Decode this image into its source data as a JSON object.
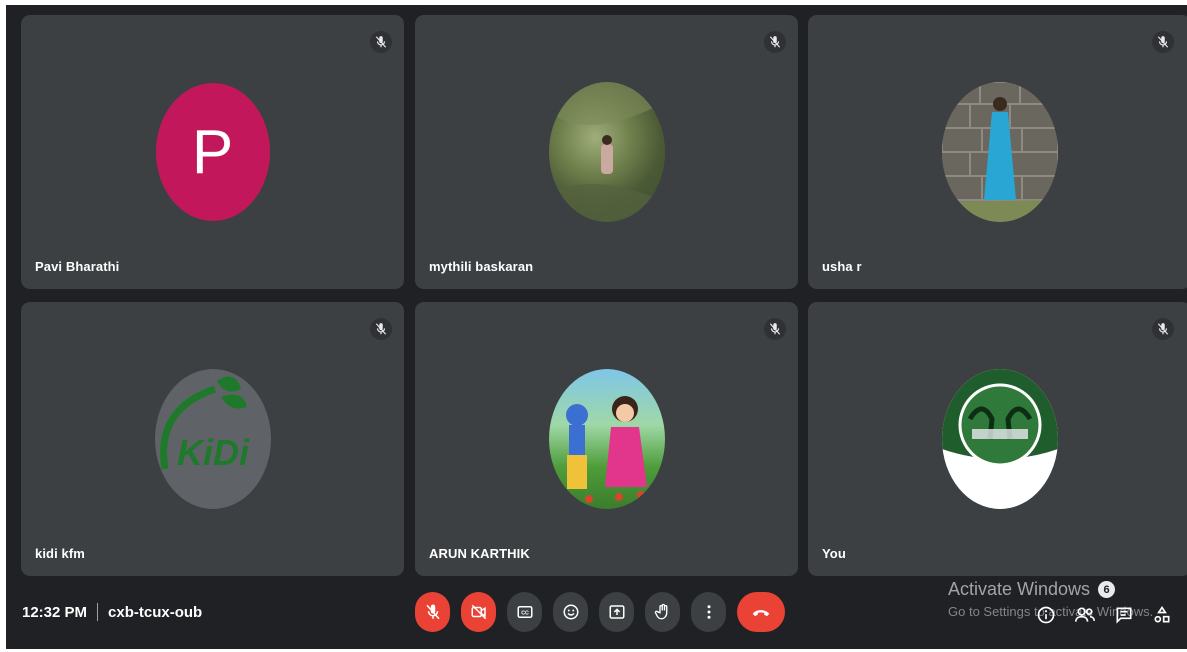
{
  "participants": [
    {
      "name": "Pavi Bharathi",
      "avatar_letter": "P",
      "avatar_type": "letter",
      "avatar_color": "#c2185b"
    },
    {
      "name": "mythili baskaran",
      "avatar_type": "photo"
    },
    {
      "name": "usha r",
      "avatar_type": "photo"
    },
    {
      "name": "kidi kfm",
      "avatar_type": "logo",
      "logo_text": "KiDi"
    },
    {
      "name": "ARUN KARTHIK",
      "avatar_type": "cartoon"
    },
    {
      "name": "You",
      "avatar_type": "logo"
    }
  ],
  "meeting": {
    "time": "12:32 PM",
    "code": "cxb-tcux-oub"
  },
  "controls": [
    "mic-off-icon",
    "camera-off-icon",
    "captions-icon",
    "emoji-icon",
    "present-icon",
    "raise-hand-icon",
    "more-options-icon",
    "end-call-icon"
  ],
  "right_panel": {
    "people_count": "6"
  },
  "watermark": {
    "title": "Activate Windows",
    "subtitle": "Go to Settings to activate Windows."
  },
  "colors": {
    "background": "#202124",
    "tile": "#3c4043",
    "danger": "#ea4335"
  }
}
